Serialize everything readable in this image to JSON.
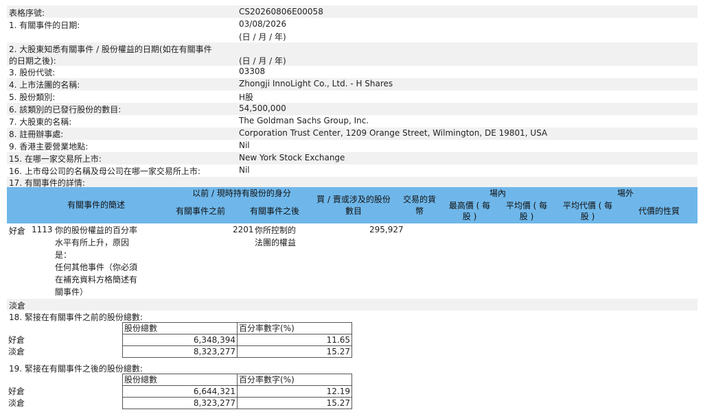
{
  "serial": {
    "label": "表格序號:",
    "value": "CS20260806E00058"
  },
  "f1": {
    "label": "1. 有關事件的日期:",
    "value": "03/08/2026",
    "format": "(日 / 月 / 年)"
  },
  "f2": {
    "label_line1": "2. 大股東知悉有關事件 / 股份權益的日期(如在有關事件",
    "label_line2": "的日期之後):",
    "format": "(日 / 月 / 年)"
  },
  "f3": {
    "label": "3. 股份代號:",
    "value": "03308"
  },
  "f4": {
    "label": "4. 上市法團的名稱:",
    "value": "Zhongji InnoLight Co., Ltd. - H Shares"
  },
  "f5": {
    "label": "5. 股份類別:",
    "value": "H股"
  },
  "f6": {
    "label": "6. 該類別的已發行股份的數目:",
    "value": "54,500,000"
  },
  "f7": {
    "label": "7. 大股東的名稱:",
    "value": "The Goldman Sachs Group, Inc."
  },
  "f8": {
    "label": "8. 註冊辦事處:",
    "value": "Corporation Trust Center, 1209 Orange Street, Wilmington, DE 19801, USA"
  },
  "f9": {
    "label": "9. 香港主要營業地點:",
    "value": "Nil"
  },
  "f15": {
    "label": "15. 在哪一家交易所上市:",
    "value": "New York Stock Exchange"
  },
  "f16": {
    "label": "16. 上市母公司的名稱及母公司在哪一家交易所上市:",
    "value": "Nil"
  },
  "f17": {
    "label": "17. 有關事件的詳情:"
  },
  "table_header": {
    "desc": "有關事件的簡述",
    "capacity": "以前 / 現時持有股份的身分",
    "before": "有關事件之前",
    "after": "有關事件之後",
    "shares_l1": "買 / 賣或涉及的股份",
    "shares_l2": "數目",
    "currency_l1": "交易的貨",
    "currency_l2": "幣",
    "onex": "場內",
    "high_l1": "最高價 ( 每",
    "high_l2": "股 )",
    "avg_l1": "平均價 ( 每",
    "avg_l2": "股 )",
    "offex": "場外",
    "avgc_l1": "平均代價 ( 每",
    "avgc_l2": "股 )",
    "nature": "代價的性質"
  },
  "event": {
    "position": "好倉",
    "code": "1113",
    "desc_lines": [
      "你的股份權益的百分率",
      "水平有所上升，原因",
      "是：",
      "任何其他事件（你必須",
      "在補充資料方格簡述有",
      "關事件）"
    ],
    "after_code": "2201",
    "after_lines": [
      "你所控制的",
      "法團的權益"
    ],
    "shares": "295,927"
  },
  "short_label": "淡倉",
  "f18": {
    "label": "18. 緊接在有關事件之前的股份總數:",
    "col1": "股份總數",
    "col2": "百分率數字(%)",
    "rows": [
      {
        "pos": "好倉",
        "shares": "6,348,394",
        "pct": "11.65"
      },
      {
        "pos": "淡倉",
        "shares": "8,323,277",
        "pct": "15.27"
      }
    ]
  },
  "f19": {
    "label": "19. 緊接在有關事件之後的股份總數:",
    "col1": "股份總數",
    "col2": "百分率數字(%)",
    "rows": [
      {
        "pos": "好倉",
        "shares": "6,644,321",
        "pct": "12.19"
      },
      {
        "pos": "淡倉",
        "shares": "8,323,277",
        "pct": "15.27"
      }
    ]
  }
}
